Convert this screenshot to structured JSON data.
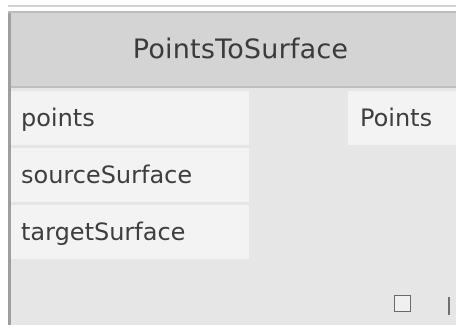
{
  "node": {
    "title": "PointsToSurface",
    "inputs": [
      {
        "label": "points"
      },
      {
        "label": "sourceSurface"
      },
      {
        "label": "targetSurface"
      }
    ],
    "outputs": [
      {
        "label": "Points"
      }
    ]
  }
}
